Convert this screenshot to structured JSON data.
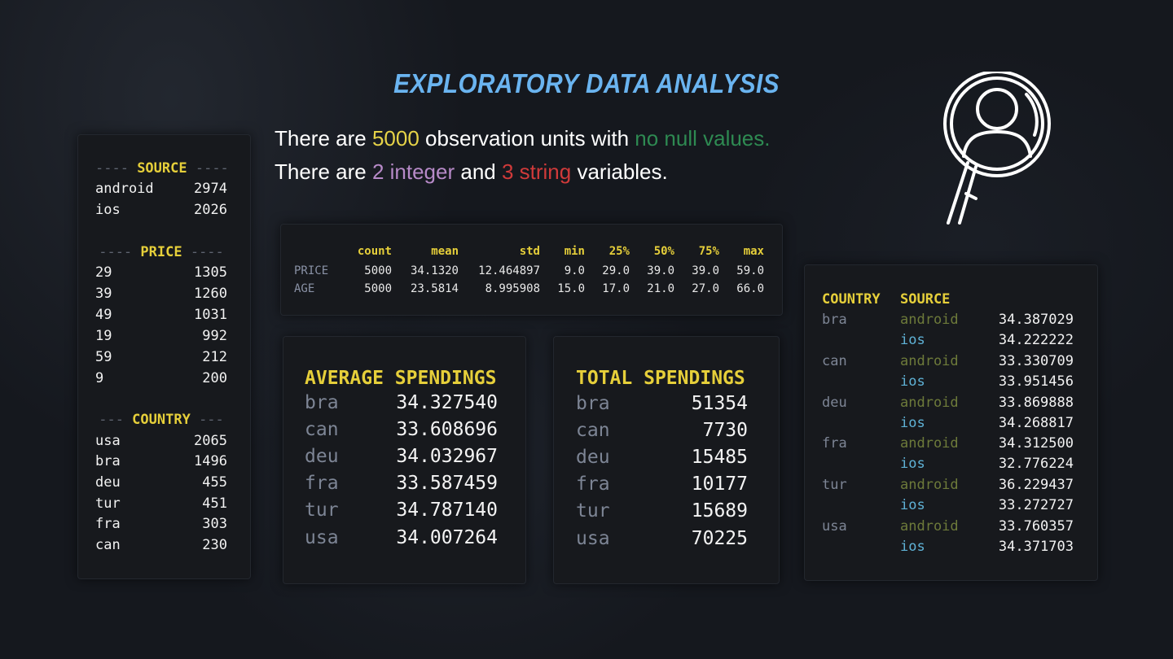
{
  "title": "EXPLORATORY DATA ANALYSIS",
  "intro": {
    "line1": {
      "pre": "There are ",
      "count": "5000",
      "mid": " observation units with ",
      "note": "no null values."
    },
    "line2": {
      "pre": "There are ",
      "int": "2 integer",
      "and": " and ",
      "str": "3 string",
      "post": " variables."
    }
  },
  "colors": {
    "accent_yellow": "#e6cf3a",
    "title_blue": "#6ab4f0",
    "green": "#2e8a52",
    "purple": "#b78ac8",
    "red": "#d03a3a",
    "ios_blue": "#5fb2d6",
    "android_olive": "#6d7a3a"
  },
  "value_counts": {
    "source": {
      "title": "SOURCE",
      "rows": [
        [
          "android",
          "2974"
        ],
        [
          "ios",
          "2026"
        ]
      ]
    },
    "price": {
      "title": "PRICE",
      "rows": [
        [
          "29",
          "1305"
        ],
        [
          "39",
          "1260"
        ],
        [
          "49",
          "1031"
        ],
        [
          "19",
          "992"
        ],
        [
          "59",
          "212"
        ],
        [
          "9",
          "200"
        ]
      ]
    },
    "country": {
      "title": "COUNTRY",
      "rows": [
        [
          "usa",
          "2065"
        ],
        [
          "bra",
          "1496"
        ],
        [
          "deu",
          "455"
        ],
        [
          "tur",
          "451"
        ],
        [
          "fra",
          "303"
        ],
        [
          "can",
          "230"
        ]
      ]
    }
  },
  "describe": {
    "columns": [
      "",
      "count",
      "mean",
      "std",
      "min",
      "25%",
      "50%",
      "75%",
      "max"
    ],
    "rows": [
      [
        "PRICE",
        "5000",
        "34.1320",
        "12.464897",
        "9.0",
        "29.0",
        "39.0",
        "39.0",
        "59.0"
      ],
      [
        "AGE",
        "5000",
        "23.5814",
        "8.995908",
        "15.0",
        "17.0",
        "21.0",
        "27.0",
        "66.0"
      ]
    ]
  },
  "average_spendings": {
    "h1": "AVERAGE",
    "h2": "SPENDINGS",
    "rows": [
      [
        "bra",
        "34.327540"
      ],
      [
        "can",
        "33.608696"
      ],
      [
        "deu",
        "34.032967"
      ],
      [
        "fra",
        "33.587459"
      ],
      [
        "tur",
        "34.787140"
      ],
      [
        "usa",
        "34.007264"
      ]
    ]
  },
  "total_spendings": {
    "h1": "TOTAL",
    "h2": "SPENDINGS",
    "rows": [
      [
        "bra",
        "51354"
      ],
      [
        "can",
        "7730"
      ],
      [
        "deu",
        "15485"
      ],
      [
        "fra",
        "10177"
      ],
      [
        "tur",
        "15689"
      ],
      [
        "usa",
        "70225"
      ]
    ]
  },
  "group_means": {
    "h_country": "COUNTRY",
    "h_source": "SOURCE",
    "groups": [
      {
        "country": "bra",
        "android": "34.387029",
        "ios": "34.222222"
      },
      {
        "country": "can",
        "android": "33.330709",
        "ios": "33.951456"
      },
      {
        "country": "deu",
        "android": "33.869888",
        "ios": "34.268817"
      },
      {
        "country": "fra",
        "android": "34.312500",
        "ios": "32.776224"
      },
      {
        "country": "tur",
        "android": "36.229437",
        "ios": "33.272727"
      },
      {
        "country": "usa",
        "android": "33.760357",
        "ios": "34.371703"
      }
    ],
    "android_label": "android",
    "ios_label": "ios"
  },
  "icons": {
    "lens": "user-search-icon"
  }
}
